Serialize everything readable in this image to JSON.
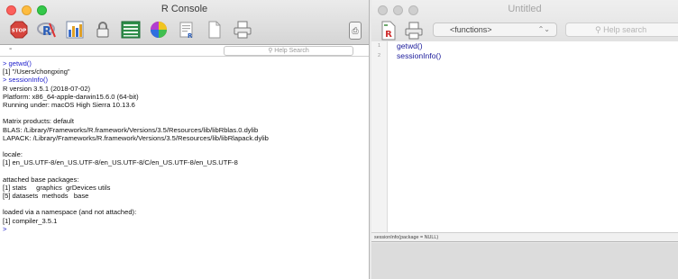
{
  "console": {
    "title": "R Console",
    "toolbar_icons": [
      "stop-icon",
      "r-logo-icon",
      "chart-icon",
      "lock-icon",
      "table-icon",
      "color-wheel-icon",
      "source-doc-icon",
      "new-doc-icon",
      "print-icon"
    ],
    "page_button": "⎙",
    "status_dash": "-",
    "help_search_placeholder": "Help Search",
    "lines": [
      {
        "text": "> getwd()",
        "kind": "cmd"
      },
      {
        "text": "[1] \"/Users/chongxing\"",
        "kind": "out"
      },
      {
        "text": "> sessionInfo()",
        "kind": "cmd"
      },
      {
        "text": "R version 3.5.1 (2018-07-02)",
        "kind": "out"
      },
      {
        "text": "Platform: x86_64-apple-darwin15.6.0 (64-bit)",
        "kind": "out"
      },
      {
        "text": "Running under: macOS High Sierra 10.13.6",
        "kind": "out"
      },
      {
        "text": "",
        "kind": "out"
      },
      {
        "text": "Matrix products: default",
        "kind": "out"
      },
      {
        "text": "BLAS: /Library/Frameworks/R.framework/Versions/3.5/Resources/lib/libRblas.0.dylib",
        "kind": "out"
      },
      {
        "text": "LAPACK: /Library/Frameworks/R.framework/Versions/3.5/Resources/lib/libRlapack.dylib",
        "kind": "out"
      },
      {
        "text": "",
        "kind": "out"
      },
      {
        "text": "locale:",
        "kind": "out"
      },
      {
        "text": "[1] en_US.UTF-8/en_US.UTF-8/en_US.UTF-8/C/en_US.UTF-8/en_US.UTF-8",
        "kind": "out"
      },
      {
        "text": "",
        "kind": "out"
      },
      {
        "text": "attached base packages:",
        "kind": "out"
      },
      {
        "text": "[1] stats     graphics  grDevices utils",
        "kind": "out"
      },
      {
        "text": "[5] datasets  methods   base",
        "kind": "out"
      },
      {
        "text": "",
        "kind": "out"
      },
      {
        "text": "loaded via a namespace (and not attached):",
        "kind": "out"
      },
      {
        "text": "[1] compiler_3.5.1",
        "kind": "out"
      },
      {
        "text": ">",
        "kind": "cmd"
      }
    ]
  },
  "editor": {
    "title": "Untitled",
    "functions_label": "<functions>",
    "functions_arrow": "⌃⌄",
    "search_placeholder": "Help search",
    "line_numbers": [
      "1",
      "2"
    ],
    "code_lines": [
      "getwd()",
      "sessionInfo()"
    ],
    "status": "sessionInfo(package = NULL)"
  },
  "colors": {
    "command_blue": "#1d1dcc",
    "editor_code_blue": "#1a1a9a"
  }
}
